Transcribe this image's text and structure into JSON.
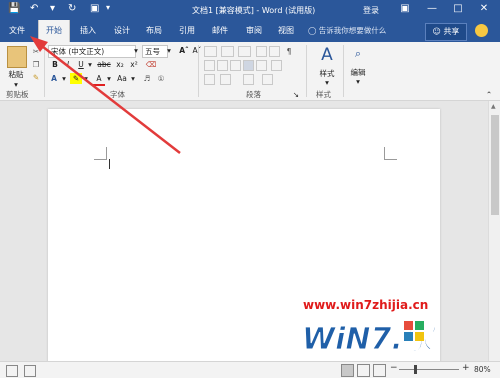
{
  "titlebar": {
    "title": "文档1 [兼容模式] - Word (试用版)",
    "login": "登录",
    "icons": [
      "save-icon",
      "undo-icon",
      "redo-icon",
      "customize-icon"
    ]
  },
  "tabs": {
    "items": [
      "文件",
      "开始",
      "插入",
      "设计",
      "布局",
      "引用",
      "邮件",
      "审阅",
      "视图"
    ],
    "active": "开始",
    "tell_me": "告诉我你想要做什么",
    "share": "共享"
  },
  "ribbon": {
    "clipboard": {
      "paste_label": "粘贴",
      "group_label": "剪贴板"
    },
    "font": {
      "font_name": "宋体 (中文正文)",
      "font_size": "五号",
      "group_label": "字体",
      "row2": [
        "B",
        "I",
        "U",
        "abc",
        "x₂",
        "x²"
      ],
      "row3": [
        "A",
        "A",
        "Aa"
      ]
    },
    "paragraph": {
      "group_label": "段落"
    },
    "styles": {
      "label": "样式",
      "group_label": "样式"
    },
    "editing": {
      "label": "编辑"
    }
  },
  "watermark": {
    "url": "www.win7zhijia.cn",
    "logo_text": "WiN7.家"
  },
  "statusbar": {
    "zoom": "80%"
  },
  "colors": {
    "brand": "#2b579a",
    "arrow": "#e23b3b",
    "watermark_red": "#e01b1b",
    "watermark_blue": "#1f5fa8"
  }
}
